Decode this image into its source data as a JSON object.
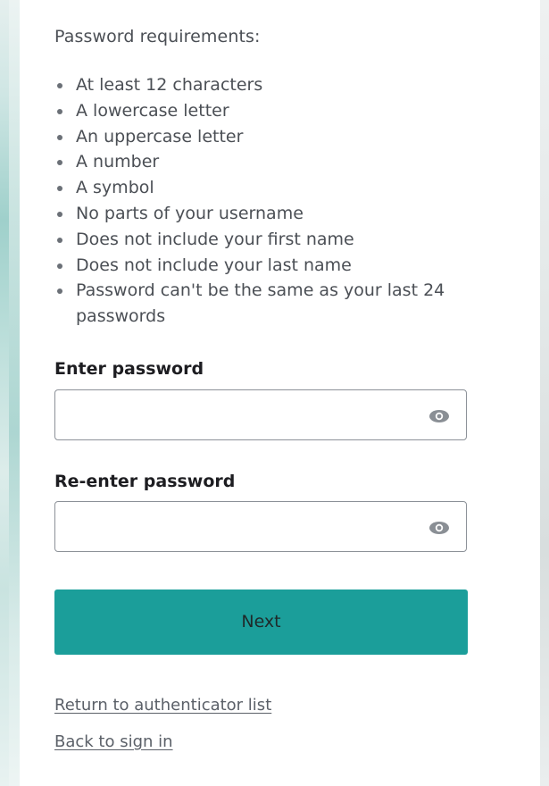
{
  "requirements": {
    "title": "Password requirements:",
    "items": [
      "At least 12 characters",
      "A lowercase letter",
      "An uppercase letter",
      "A number",
      "A symbol",
      "No parts of your username",
      "Does not include your first name",
      "Does not include your last name",
      "Password can't be the same as your last 24 passwords"
    ]
  },
  "form": {
    "password_label": "Enter password",
    "password_value": "",
    "confirm_label": "Re-enter password",
    "confirm_value": "",
    "next_label": "Next"
  },
  "links": {
    "return_label": "Return to authenticator list",
    "back_label": "Back to sign in"
  },
  "icons": {
    "show_password": "eye-icon"
  },
  "colors": {
    "accent": "#1b9e9a"
  }
}
